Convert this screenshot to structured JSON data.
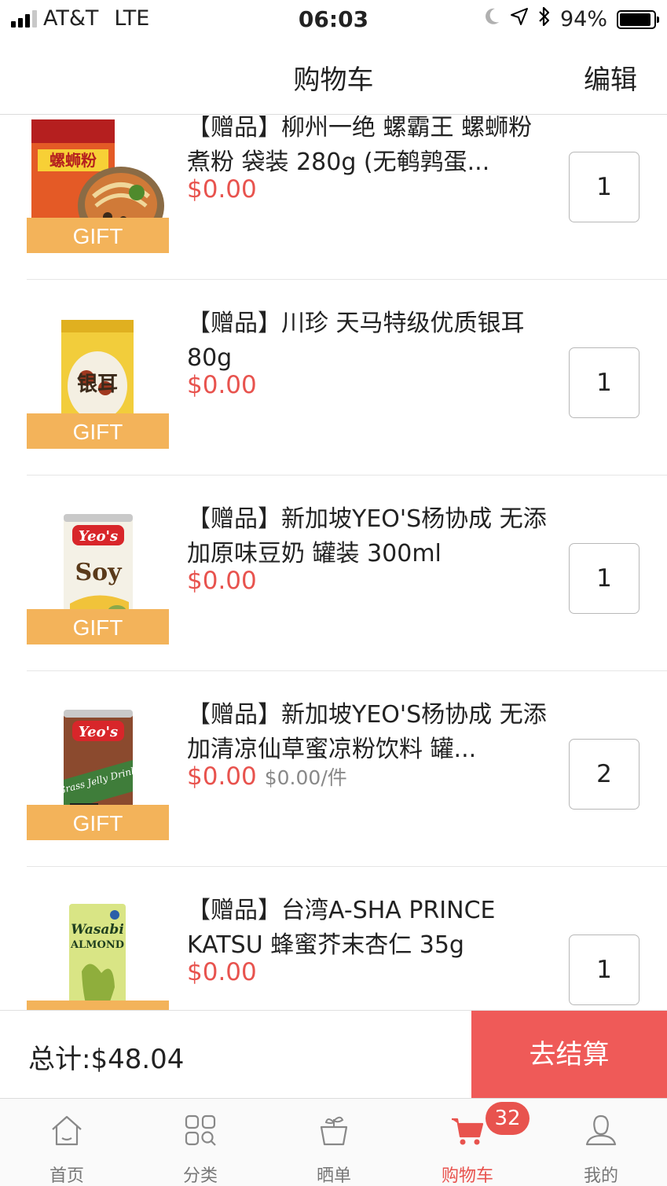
{
  "status_bar": {
    "carrier": "AT&T",
    "network": "LTE",
    "time": "06:03",
    "battery": "94%",
    "battery_level": 0.94
  },
  "nav": {
    "title": "购物车",
    "edit_label": "编辑"
  },
  "cart_items": [
    {
      "name": "【赠品】柳州一绝 螺霸王 螺蛳粉 煮粉 袋装 280g (无鹌鹑蛋...",
      "price": "$0.00",
      "unit_price": "",
      "quantity": "1",
      "badge": "GIFT",
      "image": "noodle-package-image"
    },
    {
      "name": "【赠品】川珍 天马特级优质银耳 80g",
      "price": "$0.00",
      "unit_price": "",
      "quantity": "1",
      "badge": "GIFT",
      "image": "white-fungus-package-image"
    },
    {
      "name": "【赠品】新加坡YEO'S杨协成 无添加原味豆奶 罐装 300ml",
      "price": "$0.00",
      "unit_price": "",
      "quantity": "1",
      "badge": "GIFT",
      "image": "soy-milk-can-image"
    },
    {
      "name": "【赠品】新加坡YEO'S杨协成 无添加清凉仙草蜜凉粉饮料 罐...",
      "price": "$0.00",
      "unit_price": "$0.00/件",
      "quantity": "2",
      "badge": "GIFT",
      "image": "grass-jelly-can-image"
    },
    {
      "name": "【赠品】台湾A-SHA PRINCE KATSU 蜂蜜芥末杏仁 35g",
      "price": "$0.00",
      "unit_price": "",
      "quantity": "1",
      "badge": "GIFT",
      "image": "wasabi-almond-package-image"
    }
  ],
  "checkout": {
    "total_label": "总计:",
    "total_value": "$48.04",
    "button_label": "去结算"
  },
  "tabs": [
    {
      "label": "首页",
      "icon": "home-icon"
    },
    {
      "label": "分类",
      "icon": "category-icon"
    },
    {
      "label": "晒单",
      "icon": "plant-pot-icon"
    },
    {
      "label": "购物车",
      "icon": "cart-icon",
      "badge": "32",
      "active": true
    },
    {
      "label": "我的",
      "icon": "profile-icon"
    }
  ],
  "colors": {
    "accent": "#e8534e",
    "checkout_button": "#ef5a58",
    "gift_badge": "#f3b35a"
  }
}
